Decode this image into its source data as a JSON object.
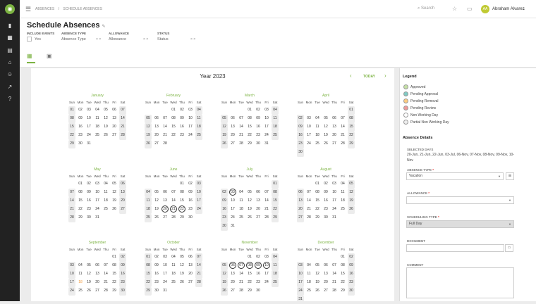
{
  "breadcrumb": {
    "root": "ABSENCES",
    "sep": "/",
    "current": "SCHEDULE ABSENCES"
  },
  "search": {
    "label": "Search"
  },
  "user": {
    "initials": "AA",
    "name": "Abraham Alvarez"
  },
  "page": {
    "title": "Schedule Absences"
  },
  "filters": {
    "include_events": {
      "label": "INCLUDE EVENTS",
      "value": "Yes"
    },
    "absence_type": {
      "label": "ABSENCE TYPE",
      "value": "Absence Type",
      "clear": "× ×"
    },
    "allowance": {
      "label": "ALLOWANCE",
      "value": "Allowance",
      "clear": "× ×"
    },
    "status": {
      "label": "STATUS",
      "value": "Status",
      "clear": "× ×"
    }
  },
  "calendar": {
    "year_label": "Year 2023",
    "today_label": "TODAY",
    "prev": "‹",
    "next": "›"
  },
  "months": [
    {
      "name": "January",
      "offset": 0,
      "days": 31,
      "circled": [],
      "orange": []
    },
    {
      "name": "February",
      "offset": 3,
      "days": 28,
      "circled": [],
      "orange": []
    },
    {
      "name": "March",
      "offset": 3,
      "days": 31,
      "circled": [],
      "orange": []
    },
    {
      "name": "April",
      "offset": 6,
      "days": 30,
      "circled": [],
      "orange": []
    },
    {
      "name": "May",
      "offset": 1,
      "days": 31,
      "circled": [],
      "orange": []
    },
    {
      "name": "June",
      "offset": 4,
      "days": 30,
      "circled": [
        20,
        21,
        22
      ],
      "orange": []
    },
    {
      "name": "July",
      "offset": 6,
      "days": 31,
      "circled": [
        3
      ],
      "orange": []
    },
    {
      "name": "August",
      "offset": 2,
      "days": 31,
      "circled": [],
      "orange": []
    },
    {
      "name": "September",
      "offset": 5,
      "days": 30,
      "circled": [],
      "orange": [
        18
      ]
    },
    {
      "name": "October",
      "offset": 0,
      "days": 31,
      "circled": [],
      "orange": []
    },
    {
      "name": "November",
      "offset": 3,
      "days": 30,
      "circled": [
        6,
        7,
        8,
        9,
        10
      ],
      "orange": []
    },
    {
      "name": "December",
      "offset": 5,
      "days": 31,
      "circled": [],
      "orange": []
    }
  ],
  "weekdays": [
    "Sun",
    "Mon",
    "Tue",
    "Wed",
    "Thu",
    "Fri",
    "Sat"
  ],
  "legend": {
    "title": "Legend",
    "items": [
      {
        "label": "Approved",
        "color": "#c5e1a5"
      },
      {
        "label": "Pending Approval",
        "color": "#80cbc4"
      },
      {
        "label": "Pending Removal",
        "color": "#ffcc80"
      },
      {
        "label": "Pending Review",
        "color": "#ef9a9a"
      },
      {
        "label": "Non Working Day",
        "color": "#ffffff"
      },
      {
        "label": "Partial Non Working Day",
        "color": "#eeeeee"
      }
    ]
  },
  "details": {
    "title": "Absence Details",
    "selected_days_label": "SELECTED DAYS",
    "selected_days_value": "20-Jun, 21-Jun, 22-Jun, 03-Jul, 06-Nov, 07-Nov, 08-Nov, 09-Nov, 10-Nov",
    "absence_type_label": "ABSENCE TYPE",
    "absence_type_value": "Vacation",
    "allowance_label": "ALLOWANCE",
    "allowance_value": "",
    "scheduling_type_label": "SCHEDULING TYPE",
    "scheduling_type_value": "Full Day",
    "document_label": "DOCUMENT",
    "comment_label": "COMMENT",
    "required_mark": "*"
  }
}
